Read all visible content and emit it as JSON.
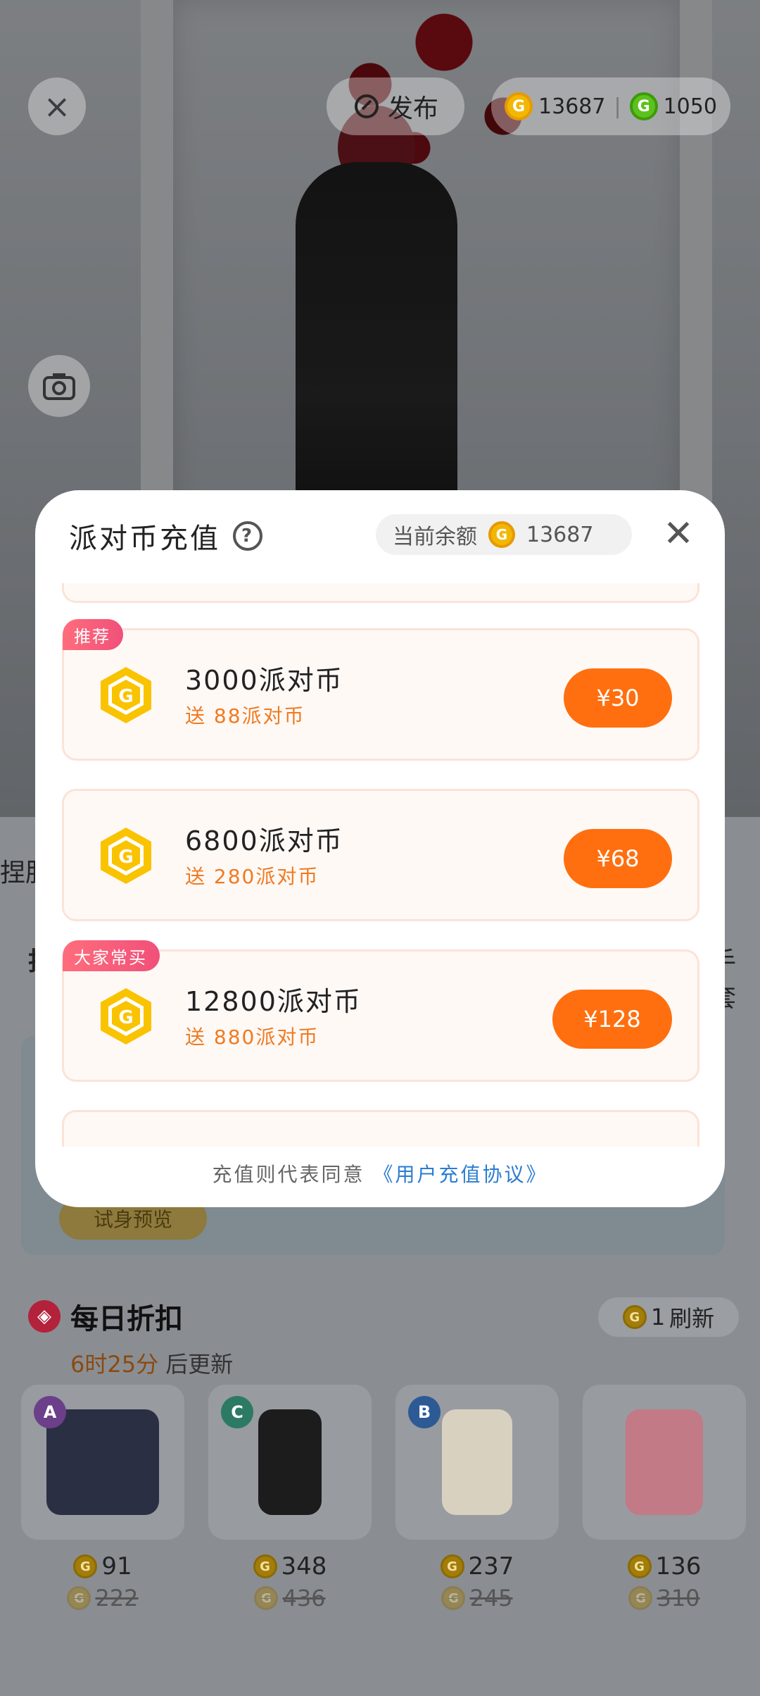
{
  "top_bar": {
    "publish_label": "发布",
    "gold_coins": "13687",
    "green_coins": "1050",
    "coin_glyph": "G"
  },
  "background_page": {
    "left_partial_text": "捏胆",
    "left_partial_text2": "拍",
    "right_partial_text": "手套",
    "banner_button": "试身预览",
    "daily_discount": {
      "title": "每日折扣",
      "refresh_cost": "1",
      "refresh_label": "刷新",
      "countdown": "6时25分",
      "countdown_suffix": "后更新",
      "items": [
        {
          "rarity": "A",
          "price": "91",
          "original": "222"
        },
        {
          "rarity": "C",
          "price": "348",
          "original": "436"
        },
        {
          "rarity": "B",
          "price": "237",
          "original": "245"
        },
        {
          "rarity": "",
          "price": "136",
          "original": "310"
        }
      ]
    }
  },
  "modal": {
    "title": "派对币充值",
    "help_icon": "?",
    "balance_label": "当前余额",
    "balance_value": "13687",
    "packages": [
      {
        "badge": "推荐",
        "amount": "3000派对币",
        "bonus": "送 88派对币",
        "price": "¥30"
      },
      {
        "badge": "",
        "amount": "6800派对币",
        "bonus": "送 280派对币",
        "price": "¥68"
      },
      {
        "badge": "大家常买",
        "amount": "12800派对币",
        "bonus": "送 880派对币",
        "price": "¥128"
      }
    ],
    "agreement_prefix": "充值则代表同意",
    "agreement_link": "《用户充值协议》"
  },
  "colors": {
    "accent_orange": "#ff6f0f",
    "bonus_text": "#f07a1f",
    "badge_pink": "#f0507a",
    "link_blue": "#2a7dd1",
    "coin_gold": "#f2b705"
  },
  "icons": [
    "close-icon",
    "publish-icon",
    "gold-coin-icon",
    "green-coin-icon",
    "camera-icon",
    "help-icon",
    "discount-tag-icon"
  ]
}
